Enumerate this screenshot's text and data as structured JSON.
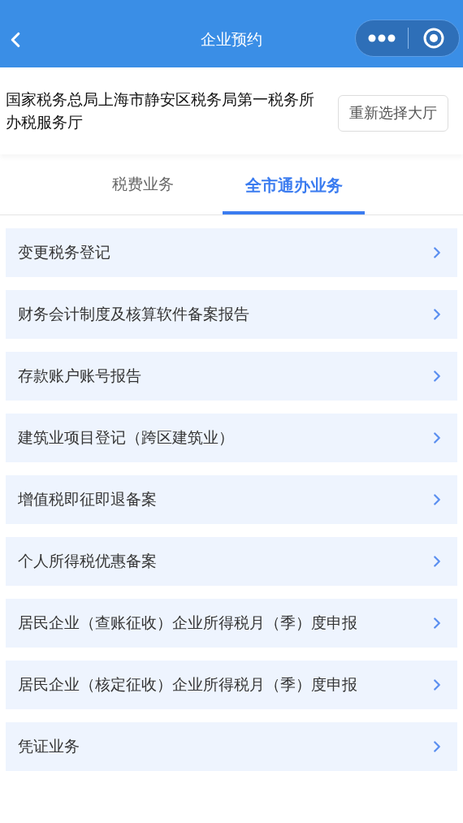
{
  "header": {
    "title": "企业预约"
  },
  "hall": {
    "name": "国家税务总局上海市静安区税务局第一税务所办税服务厅",
    "button": "重新选择大厅"
  },
  "tabs": [
    {
      "label": "税费业务",
      "selected": false
    },
    {
      "label": "全市通办业务",
      "selected": true
    }
  ],
  "items": [
    "变更税务登记",
    "财务会计制度及核算软件备案报告",
    "存款账户账号报告",
    "建筑业项目登记（跨区建筑业）",
    "增值税即征即退备案",
    "个人所得税优惠备案",
    "居民企业（查账征收）企业所得税月（季）度申报",
    "居民企业（核定征收）企业所得税月（季）度申报",
    "凭证业务"
  ]
}
